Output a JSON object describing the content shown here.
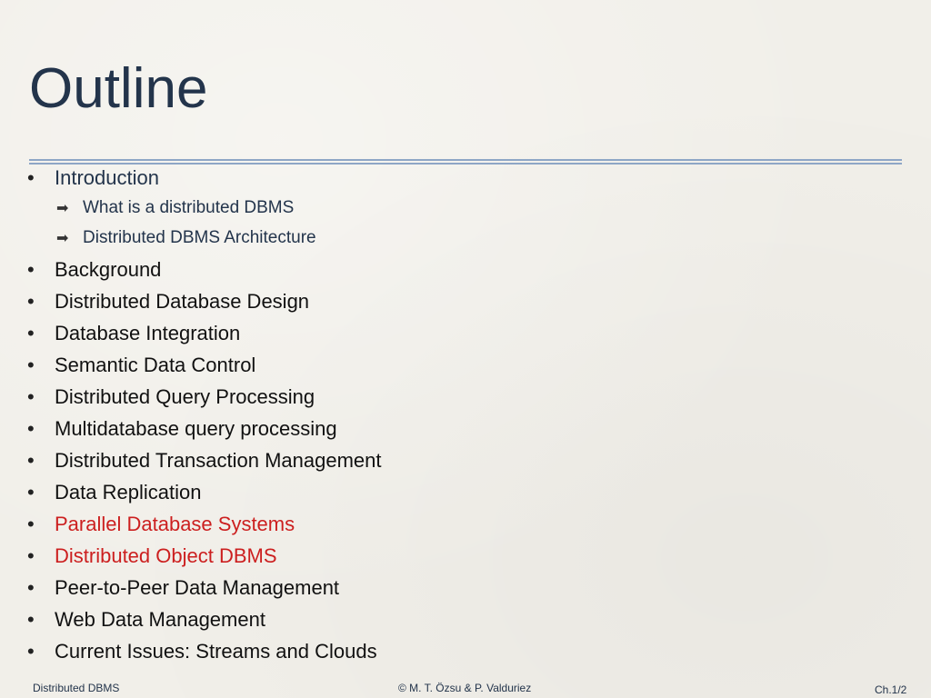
{
  "title": "Outline",
  "outline": {
    "intro": "Introduction",
    "intro_sub": [
      "What is a distributed DBMS",
      "Distributed DBMS Architecture"
    ],
    "items": [
      "Background",
      "Distributed Database Design",
      "Database Integration",
      "Semantic Data Control",
      "Distributed Query Processing",
      "Multidatabase query processing",
      "Distributed Transaction Management",
      "Data Replication",
      "Parallel Database Systems",
      "Distributed Object DBMS",
      "Peer-to-Peer Data Management",
      "Web Data Management",
      "Current Issues: Streams and Clouds"
    ]
  },
  "footer": {
    "left": "Distributed DBMS",
    "center": "© M. T. Özsu & P. Valduriez",
    "right": "Ch.1/2"
  },
  "colors": {
    "title": "#23344b",
    "highlight": "#cc1f1f",
    "rule": "#8ea6c6"
  }
}
